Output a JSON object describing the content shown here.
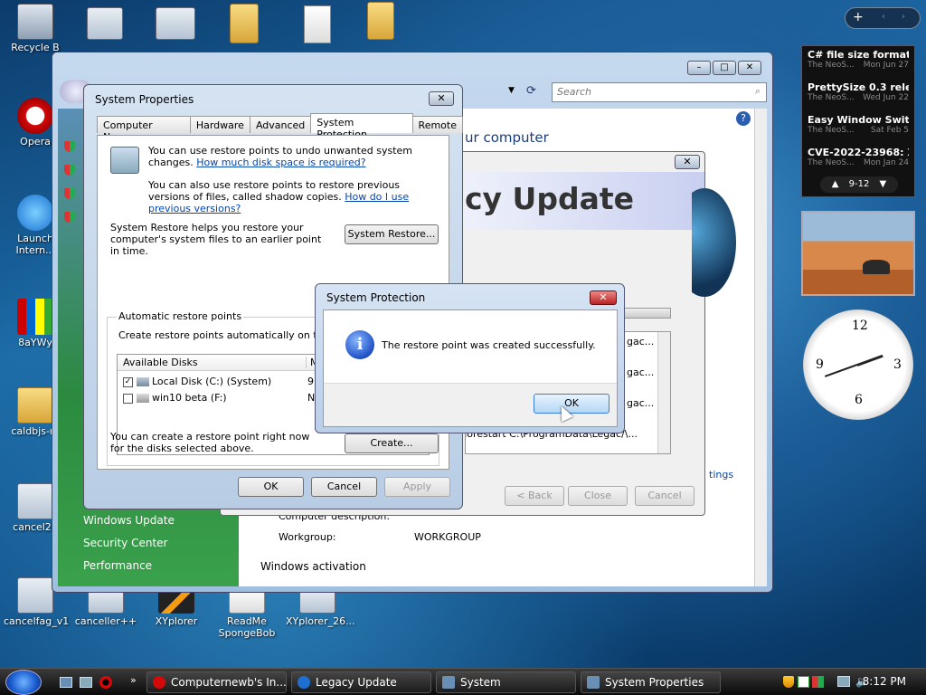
{
  "desktop": {
    "icons": [
      {
        "label": "Recycle B",
        "kind": "bin"
      },
      {
        "label": "Opera",
        "kind": "opera"
      },
      {
        "label": "Launch Intern...",
        "kind": "ie"
      },
      {
        "label": "8aYWy",
        "kind": "lego"
      },
      {
        "label": "caldbjs-m",
        "kind": "folder"
      },
      {
        "label": "cancel20",
        "kind": "app"
      },
      {
        "label": "cancelfag_v1",
        "kind": "app"
      },
      {
        "label": "canceller++",
        "kind": "app"
      },
      {
        "label": "XYplorer",
        "kind": "x"
      },
      {
        "label": "ReadMe SpongeBob",
        "kind": "doc"
      },
      {
        "label": "XYplorer_26...",
        "kind": "app"
      }
    ]
  },
  "feeds": {
    "items": [
      {
        "title": "C# file size formatting...",
        "source": "The NeoS...",
        "date": "Mon Jun 27"
      },
      {
        "title": "PrettySize 0.3 releas...",
        "source": "The NeoS...",
        "date": "Wed Jun 22"
      },
      {
        "title": "Easy Window Switch...",
        "source": "The NeoS...",
        "date": "Sat Feb 5"
      },
      {
        "title": "CVE-2022-23968: Xer...",
        "source": "The NeoS...",
        "date": "Mon Jan 24"
      }
    ],
    "page": "9-12"
  },
  "explorer": {
    "search_placeholder": "Search",
    "heading_partial": "ur computer",
    "left_links": [
      "Windows Update",
      "Security Center",
      "Performance"
    ],
    "computer_description_label": "Computer description:",
    "workgroup_label": "Workgroup:",
    "workgroup_value": "WORKGROUP",
    "activation_label": "Windows activation",
    "settings_link_partial": "tings"
  },
  "legacy": {
    "title_partial": "cy Update",
    "list_items": [
      "gac...",
      "gac...",
      "gac...",
      "gac..."
    ],
    "cmd_partial": "...\\/norestart C:\\ProgramData\\Legac...",
    "back_label": "< Back",
    "close_label": "Close",
    "cancel_label": "Cancel"
  },
  "sysprop": {
    "title": "System Properties",
    "tabs": [
      "Computer Name",
      "Hardware",
      "Advanced",
      "System Protection",
      "Remote"
    ],
    "active_tab": "System Protection",
    "intro1": "You can use restore points to undo unwanted system changes.",
    "intro1_link": "How much disk space is required?",
    "intro2": "You can also use restore points to restore previous versions of files, called shadow copies.",
    "intro2_link": "How do I use previous versions?",
    "restore_text": "System Restore helps you restore your computer's system files to an earlier point in time.",
    "restore_button": "System Restore...",
    "auto_group": "Automatic restore points",
    "auto_text": "Create restore points automatically on the selected disks:",
    "col_disks": "Available Disks",
    "col_most": "M",
    "disks": [
      {
        "name": "Local Disk (C:) (System)",
        "checked": true,
        "most": "9"
      },
      {
        "name": "win10 beta (F:)",
        "checked": false,
        "most": "N"
      }
    ],
    "create_text": "You can create a restore point right now for the disks selected above.",
    "create_button": "Create...",
    "ok": "OK",
    "cancel": "Cancel",
    "apply": "Apply"
  },
  "msgbox": {
    "title": "System Protection",
    "message": "The restore point was created successfully.",
    "ok": "OK"
  },
  "taskbar": {
    "items": [
      {
        "label": "Computernewb's In...",
        "color": "#d40a0a"
      },
      {
        "label": "Legacy Update",
        "color": "#1f6fd0"
      },
      {
        "label": "System",
        "color": "#6a8fb5"
      },
      {
        "label": "System Properties",
        "color": "#6a8fb5"
      }
    ],
    "time": "8:12 PM"
  }
}
